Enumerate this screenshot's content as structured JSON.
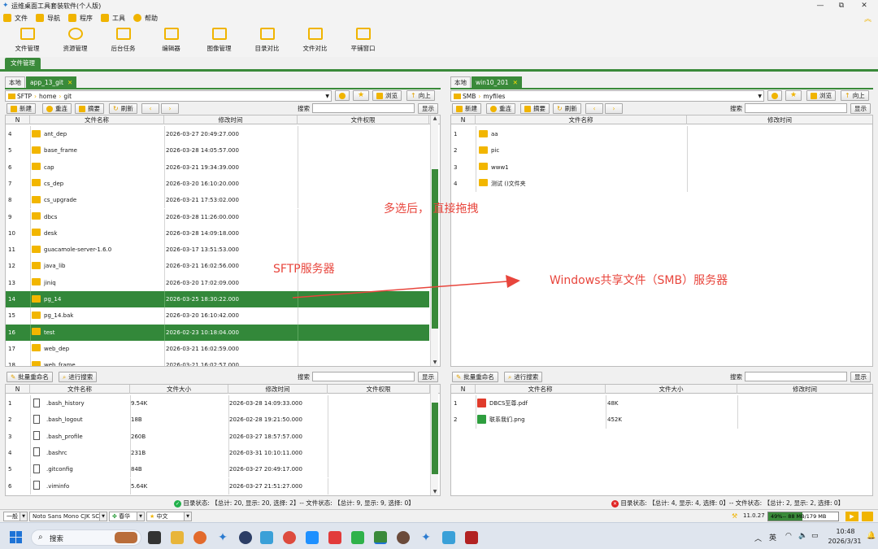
{
  "window": {
    "title": "运维桌面工具套装软件(个人版)",
    "menu": [
      "文件",
      "导航",
      "程序",
      "工具",
      "帮助"
    ],
    "controls": [
      "—",
      "⧉",
      "✕"
    ]
  },
  "toolbar": [
    "文件管理",
    "资源管理",
    "后台任务",
    "编辑器",
    "图像管理",
    "目录对比",
    "文件对比",
    "平铺窗口"
  ],
  "nav_tab": "文件管理",
  "left": {
    "tabs": [
      "本地",
      "app_13_git"
    ],
    "path": [
      "SFTP",
      "home",
      "git"
    ],
    "path_buttons": [
      "浏览",
      "向上"
    ],
    "action_buttons": [
      "新建",
      "重连",
      "摘要",
      "刷新"
    ],
    "search_label": "搜索",
    "show_button": "显示",
    "columns": [
      "N",
      "文件名称",
      "修改时间",
      "文件权限"
    ],
    "rows": [
      {
        "n": "4",
        "name": "ant_dep",
        "time": "2026-03-27 20:49:27.000"
      },
      {
        "n": "5",
        "name": "base_frame",
        "time": "2026-03-28 14:05:57.000"
      },
      {
        "n": "6",
        "name": "cap",
        "time": "2026-03-21 19:34:39.000"
      },
      {
        "n": "7",
        "name": "cs_dep",
        "time": "2026-03-20 16:10:20.000"
      },
      {
        "n": "8",
        "name": "cs_upgrade",
        "time": "2026-03-21 17:53:02.000"
      },
      {
        "n": "9",
        "name": "dbcs",
        "time": "2026-03-28 11:26:00.000"
      },
      {
        "n": "10",
        "name": "desk",
        "time": "2026-03-28 14:09:18.000"
      },
      {
        "n": "11",
        "name": "guacamole-server-1.6.0",
        "time": "2026-03-17 13:51:53.000"
      },
      {
        "n": "12",
        "name": "java_lib",
        "time": "2026-03-21 16:02:56.000"
      },
      {
        "n": "13",
        "name": "jiniq",
        "time": "2026-03-20 17:02:09.000"
      },
      {
        "n": "14",
        "name": "pg_14",
        "time": "2026-03-25 18:30:22.000",
        "selected": true
      },
      {
        "n": "15",
        "name": "pg_14.bak",
        "time": "2026-03-20 16:10:42.000"
      },
      {
        "n": "16",
        "name": "test",
        "time": "2026-02-23 10:18:04.000",
        "selected": true
      },
      {
        "n": "17",
        "name": "web_dep",
        "time": "2026-03-21 16:02:59.000"
      },
      {
        "n": "18",
        "name": "web_frame",
        "time": "2026-03-21 16:02:57.000"
      }
    ],
    "lower_buttons": [
      "批量重命名",
      "进行搜索"
    ],
    "lower_columns": [
      "N",
      "文件名称",
      "文件大小",
      "修改时间",
      "文件权限"
    ],
    "lower_rows": [
      {
        "n": "1",
        "name": ".bash_history",
        "size": "9.54K",
        "time": "2026-03-28 14:09:33.000"
      },
      {
        "n": "2",
        "name": ".bash_logout",
        "size": "18B",
        "time": "2026-02-28 19:21:50.000"
      },
      {
        "n": "3",
        "name": ".bash_profile",
        "size": "260B",
        "time": "2026-03-27 18:57:57.000"
      },
      {
        "n": "4",
        "name": ".bashrc",
        "size": "231B",
        "time": "2026-03-31 10:10:11.000"
      },
      {
        "n": "5",
        "name": ".gitconfig",
        "size": "84B",
        "time": "2026-03-27 20:49:17.000"
      },
      {
        "n": "6",
        "name": ".viminfo",
        "size": "5.64K",
        "time": "2026-03-27 21:51:27.000"
      }
    ],
    "status": "目录状态: 【总计: 20, 显示: 20, 选择: 2】-- 文件状态: 【总计: 9, 显示: 9, 选择: 0】"
  },
  "right": {
    "tabs": [
      "本地",
      "win10_201"
    ],
    "path": [
      "SMB",
      "myfiles"
    ],
    "path_buttons": [
      "浏览",
      "向上"
    ],
    "action_buttons": [
      "新建",
      "重连",
      "摘要",
      "刷新"
    ],
    "search_label": "搜索",
    "show_button": "显示",
    "columns": [
      "N",
      "文件名称",
      "修改时间"
    ],
    "rows": [
      {
        "n": "1",
        "name": "aa"
      },
      {
        "n": "2",
        "name": "pic"
      },
      {
        "n": "3",
        "name": "www1"
      },
      {
        "n": "4",
        "name": "测试 ()文件夹"
      }
    ],
    "lower_buttons": [
      "批量重命名",
      "进行搜索"
    ],
    "lower_columns": [
      "N",
      "文件名称",
      "文件大小",
      "修改时间"
    ],
    "lower_rows": [
      {
        "n": "1",
        "name": "DBCS至尊.pdf",
        "size": "48K",
        "type": "pdf"
      },
      {
        "n": "2",
        "name": "联系我们.png",
        "size": "452K",
        "type": "png"
      }
    ],
    "status": "目录状态: 【总计: 4, 显示: 4, 选择: 0】-- 文件状态: 【总计: 2, 显示: 2, 选择: 0】"
  },
  "annotations": {
    "drag_hint": "多选后， 直接拖拽",
    "sftp_label": "SFTP服务器",
    "smb_label": "Windows共享文件（SMB）服务器"
  },
  "bottom": {
    "mode": "一般",
    "font": "Noto Sans Mono CJK SC",
    "theme": "春华",
    "lang": "中文",
    "version": "11.0.27",
    "memory": "49%-- 88 MB/179 MB"
  },
  "taskbar": {
    "search": "搜索",
    "tray_lang": "英",
    "time": "10:48",
    "date": "2026/3/31"
  },
  "colors": {
    "accent": "#3a8a3a",
    "folder": "#f2b600",
    "annotation": "#e8453c"
  }
}
